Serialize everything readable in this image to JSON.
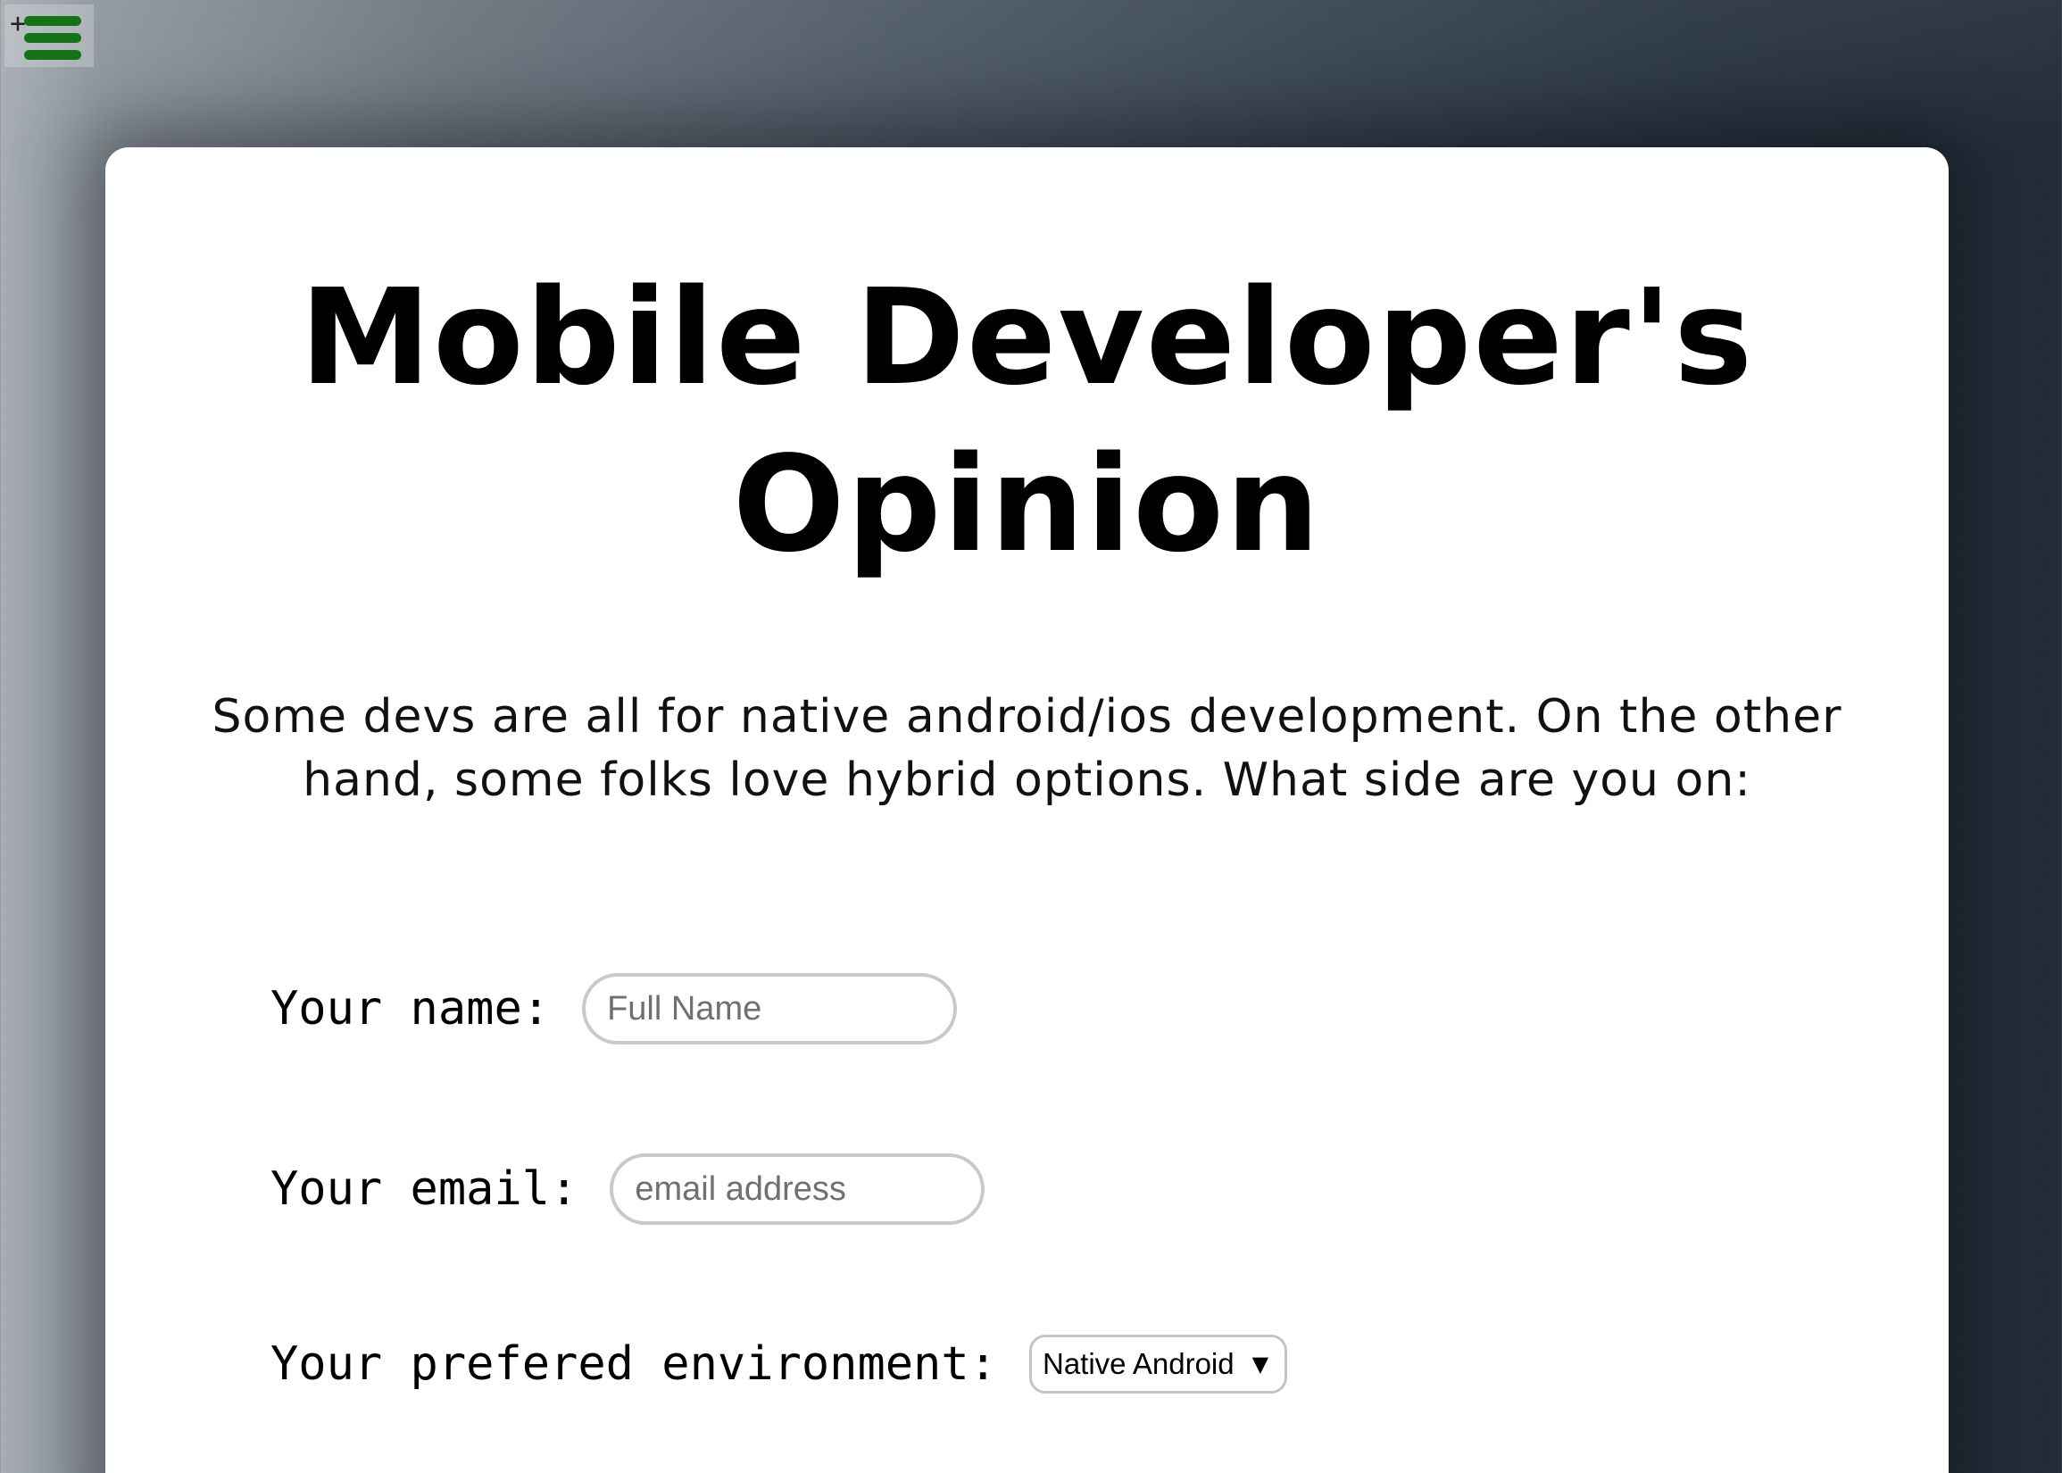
{
  "page": {
    "title": "Mobile Developer's Opinion",
    "intro": "Some devs are all for native android/ios development. On the other hand, some folks love hybrid options. What side are you on:"
  },
  "menu": {
    "icon": "hamburger-menu-icon",
    "accent_color": "#147314"
  },
  "form": {
    "name_label": "Your name:",
    "name_placeholder": "Full Name",
    "email_label": "Your email:",
    "email_placeholder": "email address",
    "environment_label": "Your prefered environment:",
    "environment_selected": "Native Android"
  }
}
